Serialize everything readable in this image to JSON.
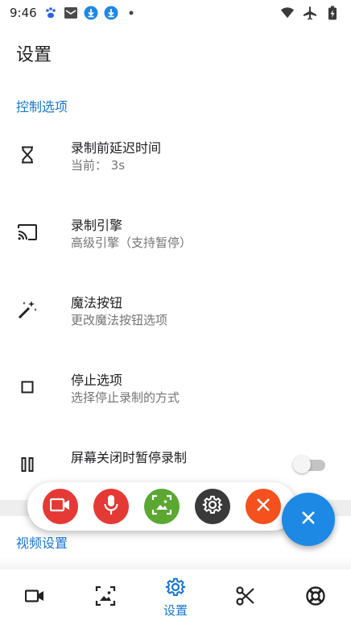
{
  "status_bar": {
    "time": "9:46",
    "left_icons": [
      "paw-icon",
      "mail-icon",
      "download-icon",
      "download-icon",
      "dot-icon"
    ],
    "right_icons": [
      "wifi-icon",
      "airplane-icon",
      "battery-charging-icon"
    ]
  },
  "page": {
    "title": "设置"
  },
  "sections": {
    "control": "控制选项",
    "video": "视频设置"
  },
  "items": [
    {
      "title": "录制前延迟时间",
      "summary": "当前： 3s",
      "icon": "hourglass-icon"
    },
    {
      "title": "录制引擎",
      "summary": "高级引擎（支持暂停）",
      "icon": "cast-icon"
    },
    {
      "title": "魔法按钮",
      "summary": "更改魔法按钮选项",
      "icon": "magic-wand-icon"
    },
    {
      "title": "停止选项",
      "summary": "选择停止录制的方式",
      "icon": "stop-square-icon"
    },
    {
      "title": "屏幕关闭时暂停录制",
      "summary": "",
      "icon": "pause-icon",
      "toggle_on": false
    }
  ],
  "bubble_toolbar": [
    {
      "icon": "video-camera-icon",
      "color": "#e53935"
    },
    {
      "icon": "microphone-icon",
      "color": "#e53935"
    },
    {
      "icon": "screenshot-image-icon",
      "color": "#5aa832"
    },
    {
      "icon": "settings-gear-icon",
      "color": "#3a3a3a"
    },
    {
      "icon": "close-x-icon",
      "color": "#f4511e"
    }
  ],
  "fab": {
    "icon": "close-icon",
    "color": "#1e88e5"
  },
  "bottom_nav": {
    "active_label": "设置",
    "items": [
      "video-tab-icon",
      "image-tab-icon",
      "settings-tab-icon",
      "edit-scissors-icon",
      "help-lifebuoy-icon"
    ],
    "accent": "#1976d2"
  }
}
